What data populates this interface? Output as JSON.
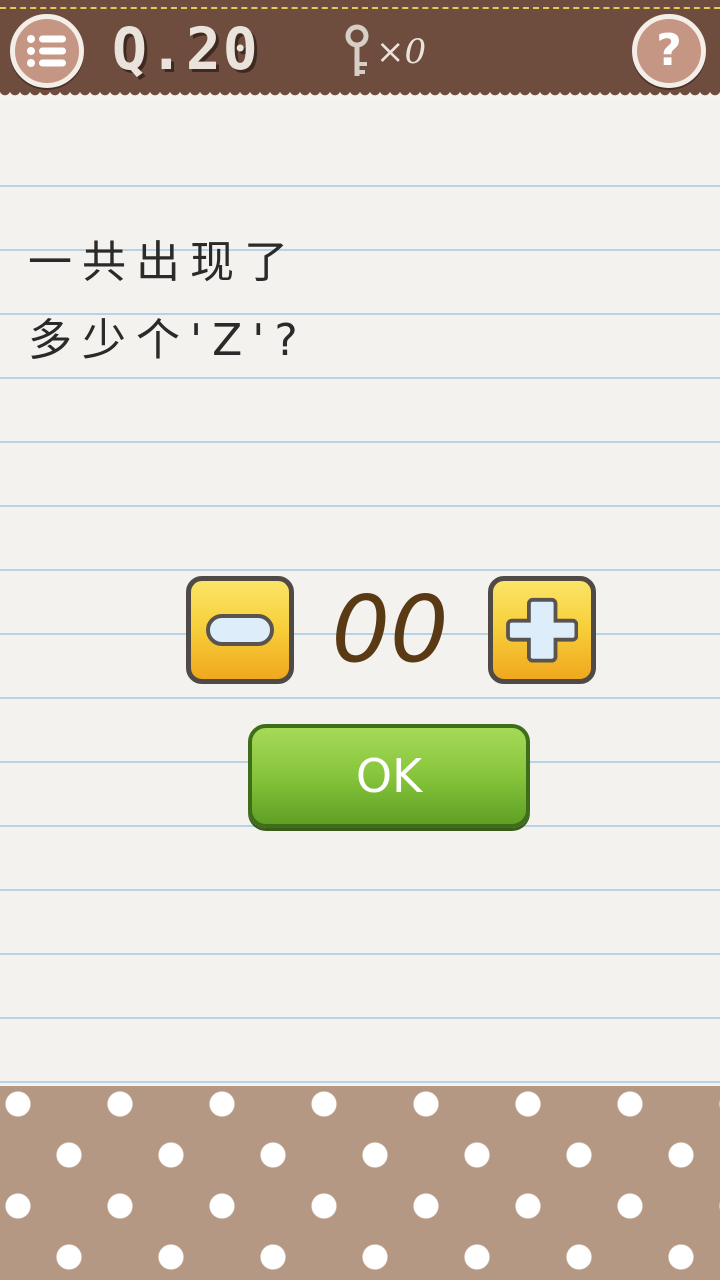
{
  "header": {
    "question_label": "Q.20",
    "key_count": "×0",
    "menu_icon": "list-menu-icon",
    "key_icon": "key-icon",
    "help_icon": "question-mark-icon",
    "help_glyph": "?"
  },
  "question": {
    "line1": "一共出现了",
    "line2": "多少个'Z'?"
  },
  "stepper": {
    "value": "00",
    "minus_icon": "minus-icon",
    "plus_icon": "plus-icon"
  },
  "ok_button": {
    "label": "OK"
  },
  "colors": {
    "header_brown": "#6e4d3e",
    "paper": "#f3f2ee",
    "paper_lines": "#b7d1e6",
    "stepper_yellow": "#f7d13c",
    "ok_green": "#86c53b",
    "footer_brown": "#b59884"
  }
}
